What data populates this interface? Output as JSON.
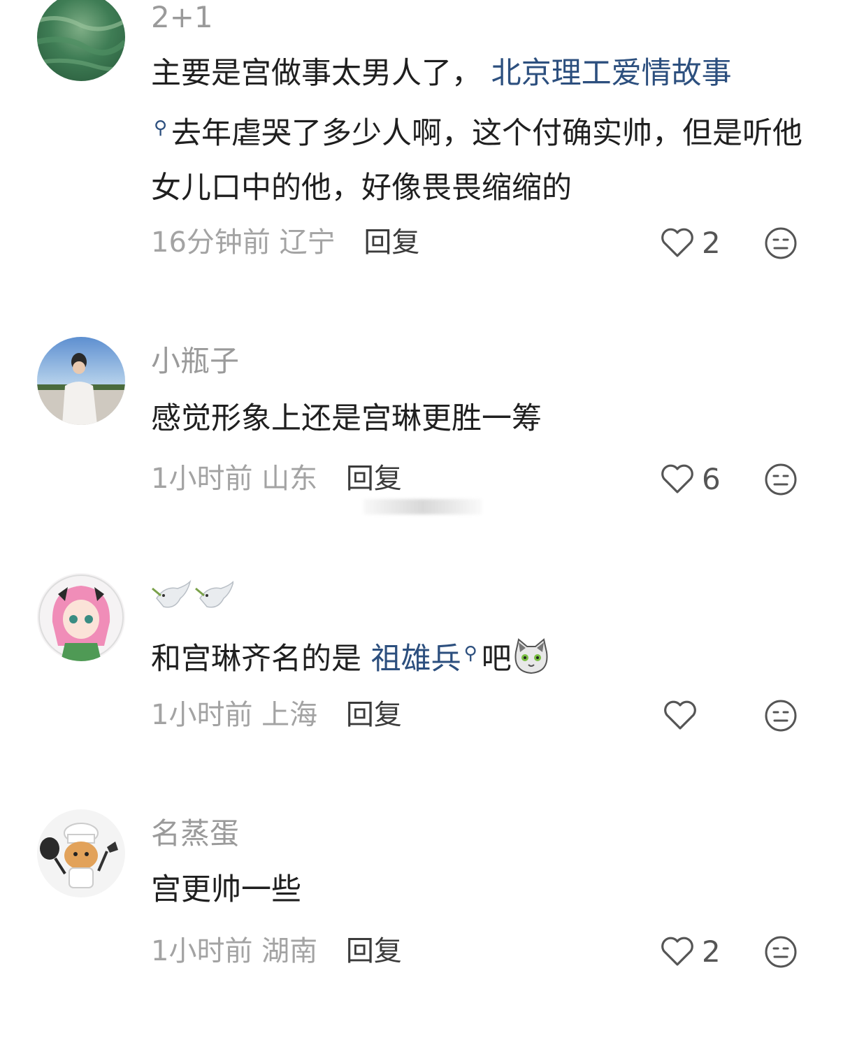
{
  "comments": [
    {
      "username": "2+1",
      "text_before_link": "主要是宫做事太男人了，",
      "link": "北京理工爱情故事",
      "text_after_link": "去年虐哭了多少人啊，这个付确实帅，但是听他女儿口中的他，好像畏畏缩缩的",
      "time": "16分钟前",
      "region": "辽宁",
      "reply_label": "回复",
      "likes": "2",
      "avatar_icon": "green-landscape-avatar"
    },
    {
      "username": "小瓶子",
      "text": "感觉形象上还是宫琳更胜一筹",
      "time": "1小时前",
      "region": "山东",
      "reply_label": "回复",
      "likes": "6",
      "avatar_icon": "person-sky-avatar"
    },
    {
      "username_icon": "dove-emoji",
      "text_before_link": "和宫琳齐名的是",
      "link": "祖雄兵",
      "text_after_link": "吧",
      "trailing_icon": "cat-emoji",
      "time": "1小时前",
      "region": "上海",
      "reply_label": "回复",
      "likes": "",
      "avatar_icon": "anime-girl-avatar"
    },
    {
      "username": "名蒸蛋",
      "text": "宫更帅一些",
      "time": "1小时前",
      "region": "湖南",
      "reply_label": "回复",
      "likes": "2",
      "avatar_icon": "chef-cat-avatar"
    }
  ],
  "colors": {
    "link": "#2c4f7e",
    "meta": "#a3a3a3",
    "username": "#9a9a9a",
    "body": "#1f1f1f"
  },
  "icons": {
    "like": "heart-outline-icon",
    "dislike": "neutral-face-icon",
    "search_link": "search-icon"
  }
}
